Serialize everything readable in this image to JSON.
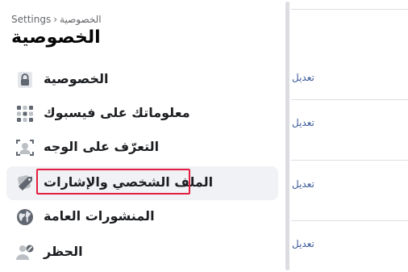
{
  "breadcrumb": {
    "root": "Settings",
    "separator": "›",
    "current": "الخصوصية"
  },
  "title": "الخصوصية",
  "menu": [
    {
      "label": "الخصوصية",
      "icon": "lock-icon",
      "selected": false,
      "highlighted": false
    },
    {
      "label": "معلوماتك على فيسبوك",
      "icon": "facebook-info-grid-icon",
      "selected": false,
      "highlighted": false
    },
    {
      "label": "التعرّف على الوجه",
      "icon": "face-recognition-icon",
      "selected": false,
      "highlighted": false
    },
    {
      "label": "الملف الشخصي والإشارات",
      "icon": "profile-tag-icon",
      "selected": true,
      "highlighted": true
    },
    {
      "label": "المنشورات العامة",
      "icon": "globe-icon",
      "selected": false,
      "highlighted": false
    },
    {
      "label": "الحظر",
      "icon": "block-user-icon",
      "selected": false,
      "highlighted": false
    }
  ],
  "edit_links": [
    "تعديل",
    "تعديل",
    "تعديل",
    "تعديل"
  ],
  "colors": {
    "link": "#385898",
    "highlight_border": "#e41e3f",
    "selected_bg": "#f0f2f5",
    "icon": "#606770"
  }
}
